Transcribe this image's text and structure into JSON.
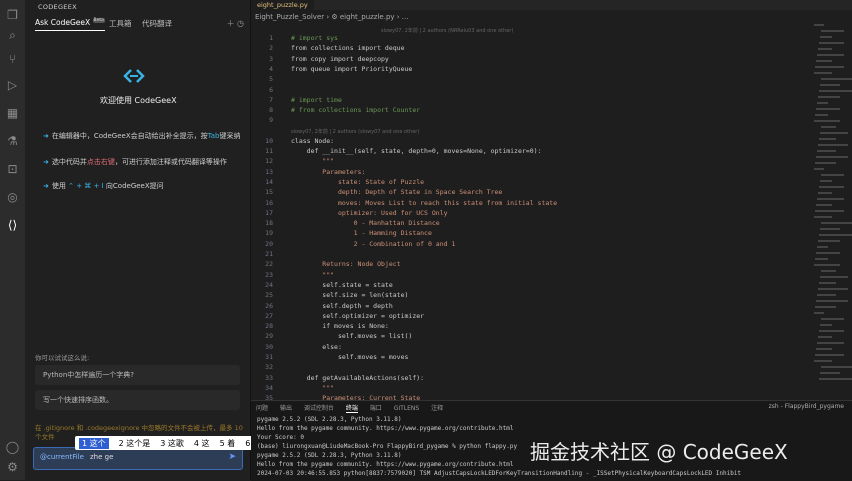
{
  "sidebar": {
    "title": "CODEGEEX",
    "tabs": [
      "Ask CodeGeeX",
      "工具箱",
      "代码翻译"
    ],
    "badge": "Beta",
    "welcome": "欢迎使用 CodeGeeX",
    "tips": [
      {
        "pre": "在编辑器中，CodeGeeX会自动给出补全提示，按",
        "key": "Tab",
        "post": "键采纳"
      },
      {
        "pre": "选中代码并",
        "key": "点击右键",
        "post": "，可进行添加注释或代码翻译等操作"
      },
      {
        "pre": "使用 ",
        "key": "⌃ + ⌘ + I",
        "post": " 向CodeGeeX提问"
      }
    ],
    "suggest_title": "你可以试试这么说:",
    "suggestions": [
      "Python中怎样遍历一个字典?",
      "写一个快速排序函数。"
    ],
    "notice": "在 .gitignore 和 .codegeexignore 中忽略的文件不会被上传，最多 10 个文件",
    "input_tag": "@currentFile",
    "input_value": "zhe ge",
    "ime_candidates": [
      "1 这个",
      "2 这个是",
      "3 这歌",
      "4 这",
      "5 着",
      "6 者",
      "7 折"
    ]
  },
  "editor": {
    "tab": "eight_puzzle.py",
    "breadcrumb": "Eight_Puzzle_Solver  ›  ⚙ eight_puzzle.py  ›  ...",
    "lens1": "slowy07, 2年前 | 2 authors (NRRelu03 and one other)",
    "lens2": "slowy07, 2年前 | 2 authors (slowy07 and one other)",
    "line_numbers": [
      "1",
      "2",
      "3",
      "4",
      "5",
      "6",
      "7",
      "8",
      "9",
      "10",
      "11",
      "12",
      "13",
      "14",
      "15",
      "16",
      "17",
      "18",
      "19",
      "20",
      "21",
      "22",
      "23",
      "24",
      "25",
      "26",
      "27",
      "28",
      "29",
      "30",
      "31",
      "32",
      "33",
      "34",
      "35"
    ],
    "lines": [
      "# import sys",
      "from collections import deque",
      "from copy import deepcopy",
      "from queue import PriorityQueue",
      "",
      "",
      "# import time",
      "# from collections import Counter",
      "",
      "class Node:",
      "    def __init__(self, state, depth=0, moves=None, optimizer=0):",
      "        \"\"\"",
      "        Parameters:",
      "            state: State of Puzzle",
      "            depth: Depth of State in Space Search Tree",
      "            moves: Moves List to reach this state from initial state",
      "            optimizer: Used for UCS Only",
      "                0 - Manhattan Distance",
      "                1 - Hamming Distance",
      "                2 - Combination of 0 and 1",
      "",
      "        Returns: Node Object",
      "        \"\"\"",
      "        self.state = state",
      "        self.size = len(state)",
      "        self.depth = depth",
      "        self.optimizer = optimizer",
      "        if moves is None:",
      "            self.moves = list()",
      "        else:",
      "            self.moves = moves",
      "",
      "    def getAvailableActions(self):",
      "        \"\"\"",
      "        Parameters: Current State"
    ]
  },
  "panel": {
    "tabs": [
      "问题",
      "输出",
      "调试控制台",
      "终端",
      "端口",
      "GITLENS",
      "注释"
    ],
    "active_tab": "终端",
    "terminal_name": "zsh - FlappyBird_pygame",
    "terminal_lines": [
      "pygame 2.5.2 (SDL 2.28.3, Python 3.11.8)",
      "Hello from the pygame community. https://www.pygame.org/contribute.html",
      "Your Score: 0",
      "(base) liurongxuan@LiudeMacBook-Pro FlappyBird_pygame % python flappy.py",
      "pygame 2.5.2 (SDL 2.28.3, Python 3.11.8)",
      "Hello from the pygame community. https://www.pygame.org/contribute.html",
      "2024-07-03 20:46:55.853 python[8837:7579020] TSM AdjustCapsLockLEDForKeyTransitionHandling - _ISSetPhysicalKeyboardCapsLockLED Inhibit"
    ]
  },
  "watermark": "掘金技术社区 @ CodeGeeX",
  "colors": {
    "accent": "#39b3e6",
    "keyword": "#569cd6",
    "string": "#ce9178",
    "comment": "#6a9955"
  }
}
